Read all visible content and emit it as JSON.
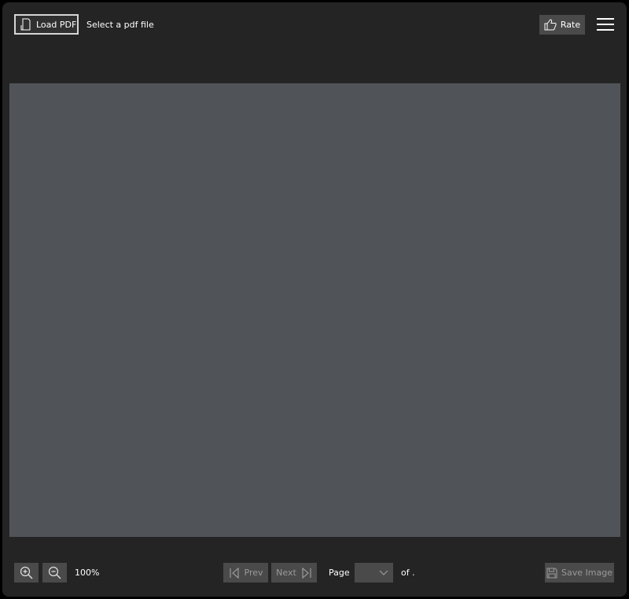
{
  "header": {
    "load_button_label": "Load PDF",
    "load_icon": "document-icon",
    "status_text": "Select a pdf file",
    "rate_button_label": "Rate",
    "rate_icon": "thumbs-up-icon",
    "menu_icon": "hamburger-menu-icon"
  },
  "viewer": {
    "canvas_color": "#505458"
  },
  "footer": {
    "zoom_in_icon": "zoom-in-icon",
    "zoom_out_icon": "zoom-out-icon",
    "zoom_level": "100%",
    "prev_label": "Prev",
    "next_label": "Next",
    "page_label": "Page",
    "page_select_value": "",
    "of_text": "of .",
    "save_image_label": "Save Image",
    "save_icon": "floppy-disk-icon"
  },
  "colors": {
    "background": "#242424",
    "button": "#4a4a4a",
    "text": "#ffffff",
    "disabled_text": "#9a9a9a"
  }
}
